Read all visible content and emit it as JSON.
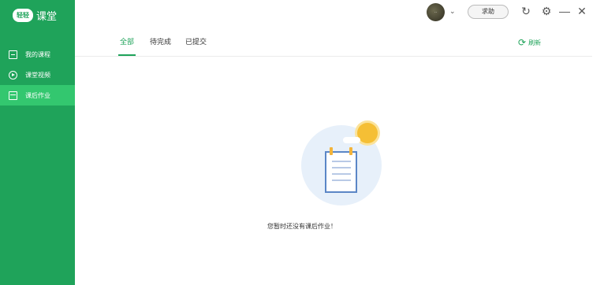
{
  "app": {
    "logo_badge": "轻轻",
    "logo_text": "课堂"
  },
  "sidebar": {
    "items": [
      {
        "label": "我的课程",
        "icon": "course-icon"
      },
      {
        "label": "课堂视频",
        "icon": "play-icon"
      },
      {
        "label": "课后作业",
        "icon": "homework-icon",
        "active": true
      }
    ]
  },
  "topbar": {
    "avatar_text": "..",
    "help_label": "求助",
    "icons": [
      "refresh-icon",
      "gear-icon",
      "minimize-icon",
      "close-icon"
    ]
  },
  "tabs": [
    {
      "label": "全部",
      "active": true
    },
    {
      "label": "待完成"
    },
    {
      "label": "已提交"
    }
  ],
  "refresh_label": "刷新",
  "empty_state": {
    "message": "您暂时还没有课后作业！"
  },
  "colors": {
    "brand": "#1fa35a",
    "active_nav": "#33c76f"
  }
}
